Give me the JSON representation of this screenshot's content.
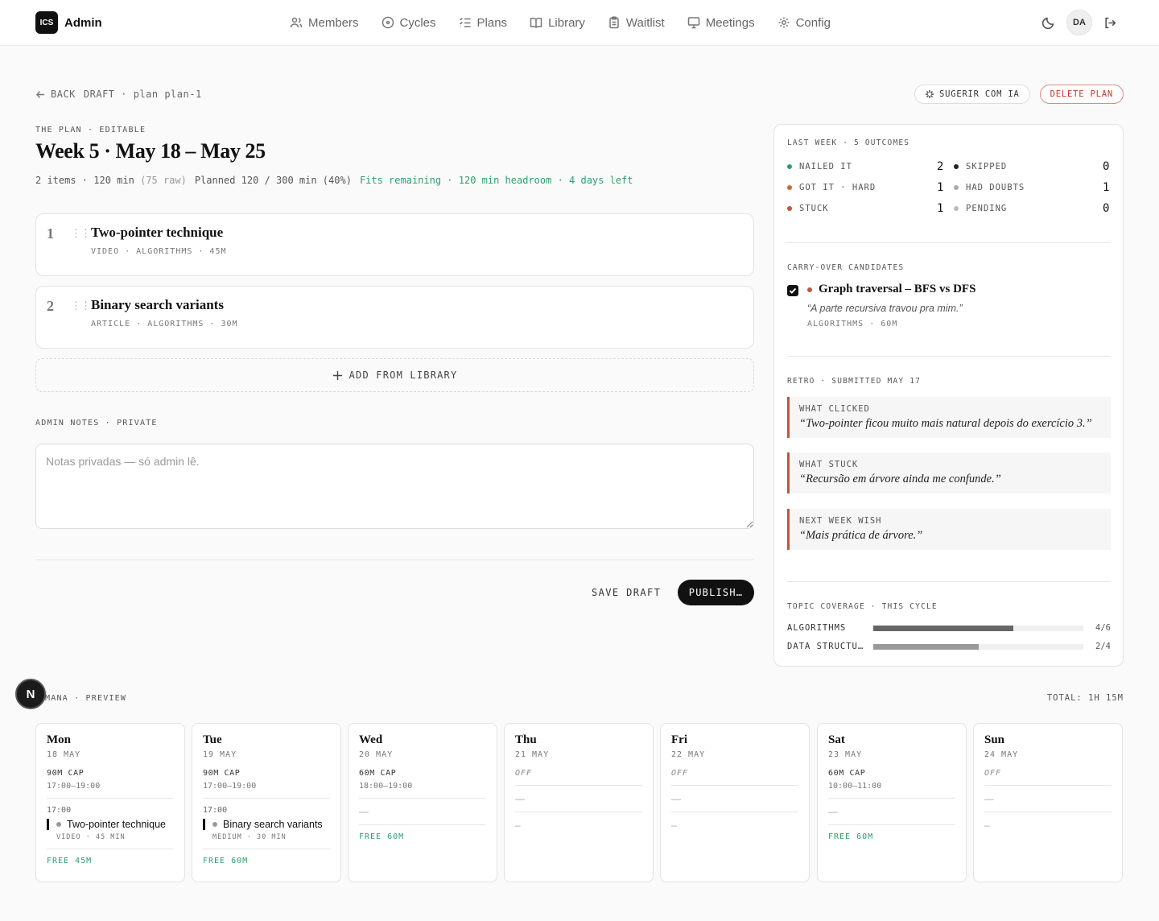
{
  "nav": {
    "logo": "ICS",
    "brand": "Admin",
    "links": [
      "Members",
      "Cycles",
      "Plans",
      "Library",
      "Waitlist",
      "Meetings",
      "Config"
    ],
    "avatar": "DA"
  },
  "crumb": {
    "back": "BACK",
    "path": "DRAFT · plan plan-1"
  },
  "actions": {
    "suggest": "SUGERIR COM IA",
    "delete": "DELETE PLAN"
  },
  "plan": {
    "eyebrow": "THE PLAN · EDITABLE",
    "title": "Week 5 · May 18 – May 25",
    "stats": {
      "items": "2 items · 120 min",
      "raw": "(75 raw)",
      "planned": "Planned 120 / 300 min (40%)",
      "fits": "Fits remaining · 120 min headroom · 4 days left"
    },
    "items": [
      {
        "num": "1",
        "name": "Two-pointer technique",
        "meta": "VIDEO · ALGORITHMS · 45M"
      },
      {
        "num": "2",
        "name": "Binary search variants",
        "meta": "ARTICLE · ALGORITHMS · 30M"
      }
    ],
    "add_label": "ADD FROM LIBRARY",
    "notes_eyebrow": "ADMIN NOTES · PRIVATE",
    "notes_placeholder": "Notas privadas — só admin lê.",
    "save_label": "SAVE DRAFT",
    "publish_label": "PUBLISH…"
  },
  "panel": {
    "last_week": "LAST WEEK · 5 OUTCOMES",
    "outcomes": [
      {
        "label": "NAILED IT",
        "count": "2",
        "color": "#2e9e6b"
      },
      {
        "label": "SKIPPED",
        "count": "0",
        "color": "#222222"
      },
      {
        "label": "GOT IT · HARD",
        "count": "1",
        "color": "#d2663f"
      },
      {
        "label": "HAD DOUBTS",
        "count": "1",
        "color": "#aaaaaa"
      },
      {
        "label": "STUCK",
        "count": "1",
        "color": "#c0563c"
      },
      {
        "label": "PENDING",
        "count": "0",
        "color": "#bbbbbb"
      }
    ],
    "carry": {
      "eyebrow": "CARRY-OVER CANDIDATES",
      "name": "Graph traversal – BFS vs DFS",
      "quote": "“A parte recursiva travou pra mim.”",
      "meta": "ALGORITHMS · 60M"
    },
    "retro": {
      "eyebrow": "RETRO · SUBMITTED MAY 17",
      "entries": [
        {
          "label": "WHAT CLICKED",
          "quote": "“Two-pointer ficou muito mais natural depois do exercício 3.”"
        },
        {
          "label": "WHAT STUCK",
          "quote": "“Recursão em árvore ainda me confunde.”"
        },
        {
          "label": "NEXT WEEK WISH",
          "quote": "“Mais prática de árvore.”"
        }
      ]
    },
    "coverage": {
      "eyebrow": "TOPIC COVERAGE · THIS CYCLE",
      "rows": [
        {
          "label": "ALGORITHMS",
          "value": "4/6",
          "fraction": 0.667
        },
        {
          "label": "DATA STRUCTU…",
          "value": "2/4",
          "fraction": 0.5
        }
      ]
    }
  },
  "week": {
    "eyebrow": "MANA · PREVIEW",
    "total": "TOTAL: 1H 15M",
    "badge": "N",
    "days": [
      {
        "name": "Mon",
        "date": "18 MAY",
        "cap": "90M CAP",
        "hours": "17:00–19:00",
        "time": "17:00",
        "task": "Two-pointer technique",
        "task_meta": "VIDEO · 45 MIN",
        "free": "FREE 45M"
      },
      {
        "name": "Tue",
        "date": "19 MAY",
        "cap": "90M CAP",
        "hours": "17:00–19:00",
        "time": "17:00",
        "task": "Binary search variants",
        "task_meta": "MEDIUM · 30 MIN",
        "free": "FREE 60M"
      },
      {
        "name": "Wed",
        "date": "20 MAY",
        "cap": "60M CAP",
        "hours": "18:00–19:00",
        "empty": "—",
        "free": "FREE 60M"
      },
      {
        "name": "Thu",
        "date": "21 MAY",
        "off": "OFF",
        "empty": "—",
        "dash2": "–"
      },
      {
        "name": "Fri",
        "date": "22 MAY",
        "off": "OFF",
        "empty": "—",
        "dash2": "–"
      },
      {
        "name": "Sat",
        "date": "23 MAY",
        "cap": "60M CAP",
        "hours": "10:00–11:00",
        "empty": "—",
        "free": "FREE 60M"
      },
      {
        "name": "Sun",
        "date": "24 MAY",
        "off": "OFF",
        "empty": "—",
        "dash2": "–"
      }
    ]
  }
}
